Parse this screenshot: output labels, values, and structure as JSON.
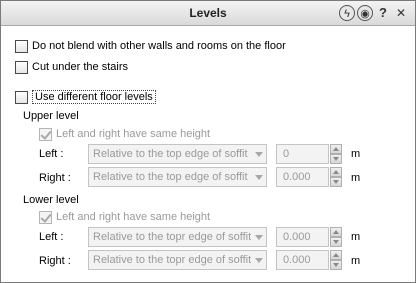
{
  "window": {
    "title": "Levels",
    "icons": [
      "lightning-icon",
      "settings-icon",
      "help-icon",
      "close-icon"
    ],
    "help_glyph": "?",
    "close_glyph": "✕"
  },
  "options": {
    "no_blend": {
      "label": "Do not blend with other walls and rooms on the floor",
      "checked": false
    },
    "cut_stairs": {
      "label": "Cut under the stairs",
      "checked": false
    },
    "diff_levels": {
      "label": "Use different floor levels",
      "checked": false
    }
  },
  "upper": {
    "heading": "Upper level",
    "same_height_label": "Left and right have same height",
    "same_height_checked": true,
    "left_label": "Left :",
    "left_mode": "Relative to the top edge of soffit",
    "left_value": "0",
    "right_label": "Right :",
    "right_mode": "Relative to the top edge of soffit",
    "right_value": "0.000"
  },
  "lower": {
    "heading": "Lower level",
    "same_height_label": "Left and right have same height",
    "same_height_checked": true,
    "left_label": "Left :",
    "left_mode": "Relative to the topr edge of soffit b",
    "left_value": "0.000",
    "right_label": "Right :",
    "right_mode": "Relative to the topr edge of soffit b",
    "right_value": "0.000"
  },
  "unit": "m"
}
